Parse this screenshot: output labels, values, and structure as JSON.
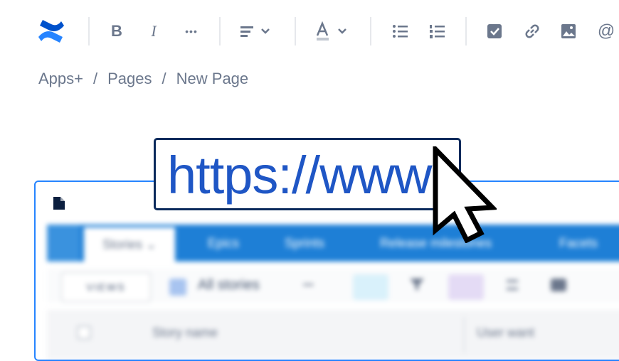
{
  "toolbar": {
    "logo": "confluence-logo",
    "accent": "#2684ff",
    "buttons": [
      "bold-icon",
      "italic-icon",
      "more-icon",
      "align-icon",
      "text-color-icon",
      "bullet-list-icon",
      "numbered-list-icon",
      "task-icon",
      "link-icon",
      "image-icon",
      "mention-icon"
    ],
    "bold": "B",
    "italic": "I",
    "more": "•••",
    "mention": "@"
  },
  "breadcrumb": {
    "items": [
      "Apps+",
      "Pages",
      "New Page"
    ],
    "separator": "/"
  },
  "url_overlay": {
    "text": "https://www",
    "color": "#1f56c5",
    "border": "#0b2a5c"
  },
  "embed": {
    "tabs": [
      "Stories",
      "Epics",
      "Sprints",
      "Release milestones",
      "Facets"
    ],
    "views_label": "VIEWS",
    "filter_label": "All stories",
    "more": "•••",
    "columns": [
      "Story name",
      "User want"
    ],
    "tabbar_color": "#1e7fd6"
  }
}
